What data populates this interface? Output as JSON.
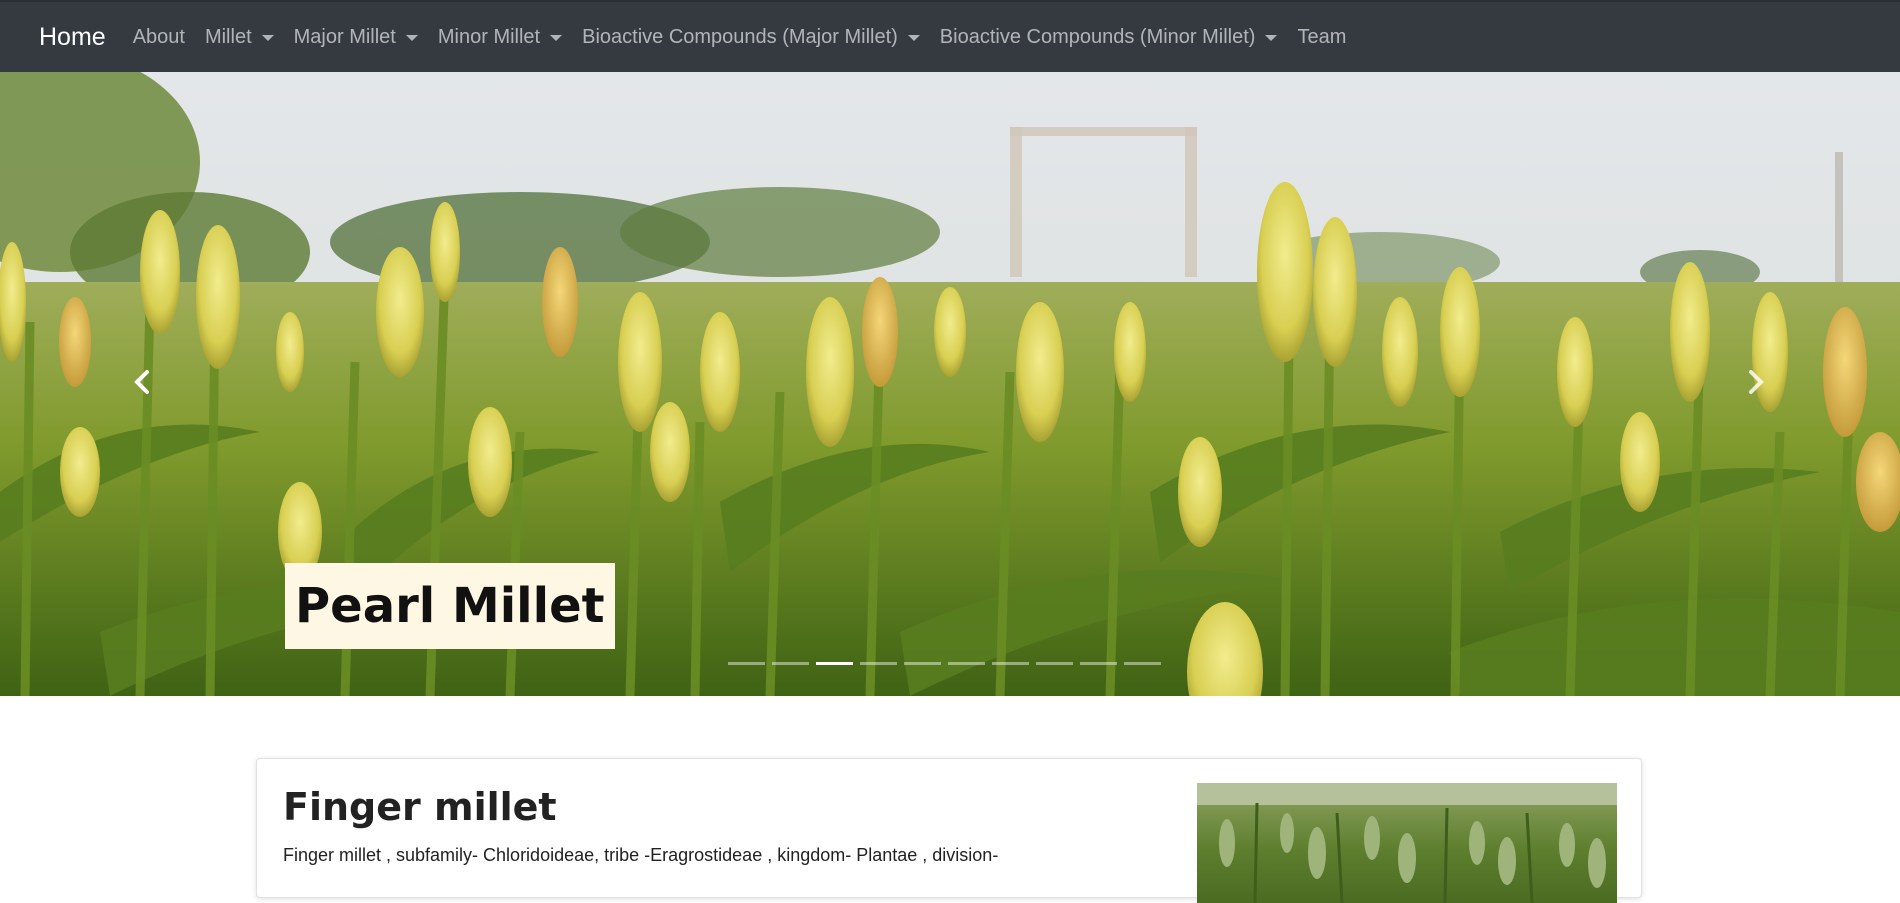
{
  "navbar": {
    "brand": "Home",
    "items": [
      {
        "label": "About",
        "dropdown": false
      },
      {
        "label": "Millet",
        "dropdown": true
      },
      {
        "label": "Major Millet",
        "dropdown": true
      },
      {
        "label": "Minor Millet",
        "dropdown": true
      },
      {
        "label": "Bioactive Compounds (Major Millet)",
        "dropdown": true
      },
      {
        "label": "Bioactive Compounds (Minor Millet)",
        "dropdown": true
      },
      {
        "label": "Team",
        "dropdown": false
      }
    ]
  },
  "carousel": {
    "caption": "Pearl Millet",
    "slide_count": 10,
    "active_index": 2,
    "prev_icon": "chevron-left-icon",
    "next_icon": "chevron-right-icon"
  },
  "card": {
    "title": "Finger millet",
    "text": "Finger millet , subfamily- Chloridoideae, tribe -Eragrostideae , kingdom- Plantae , division-"
  },
  "colors": {
    "navbar_bg": "#343a40",
    "caption_bg": "#fdf7e3"
  }
}
